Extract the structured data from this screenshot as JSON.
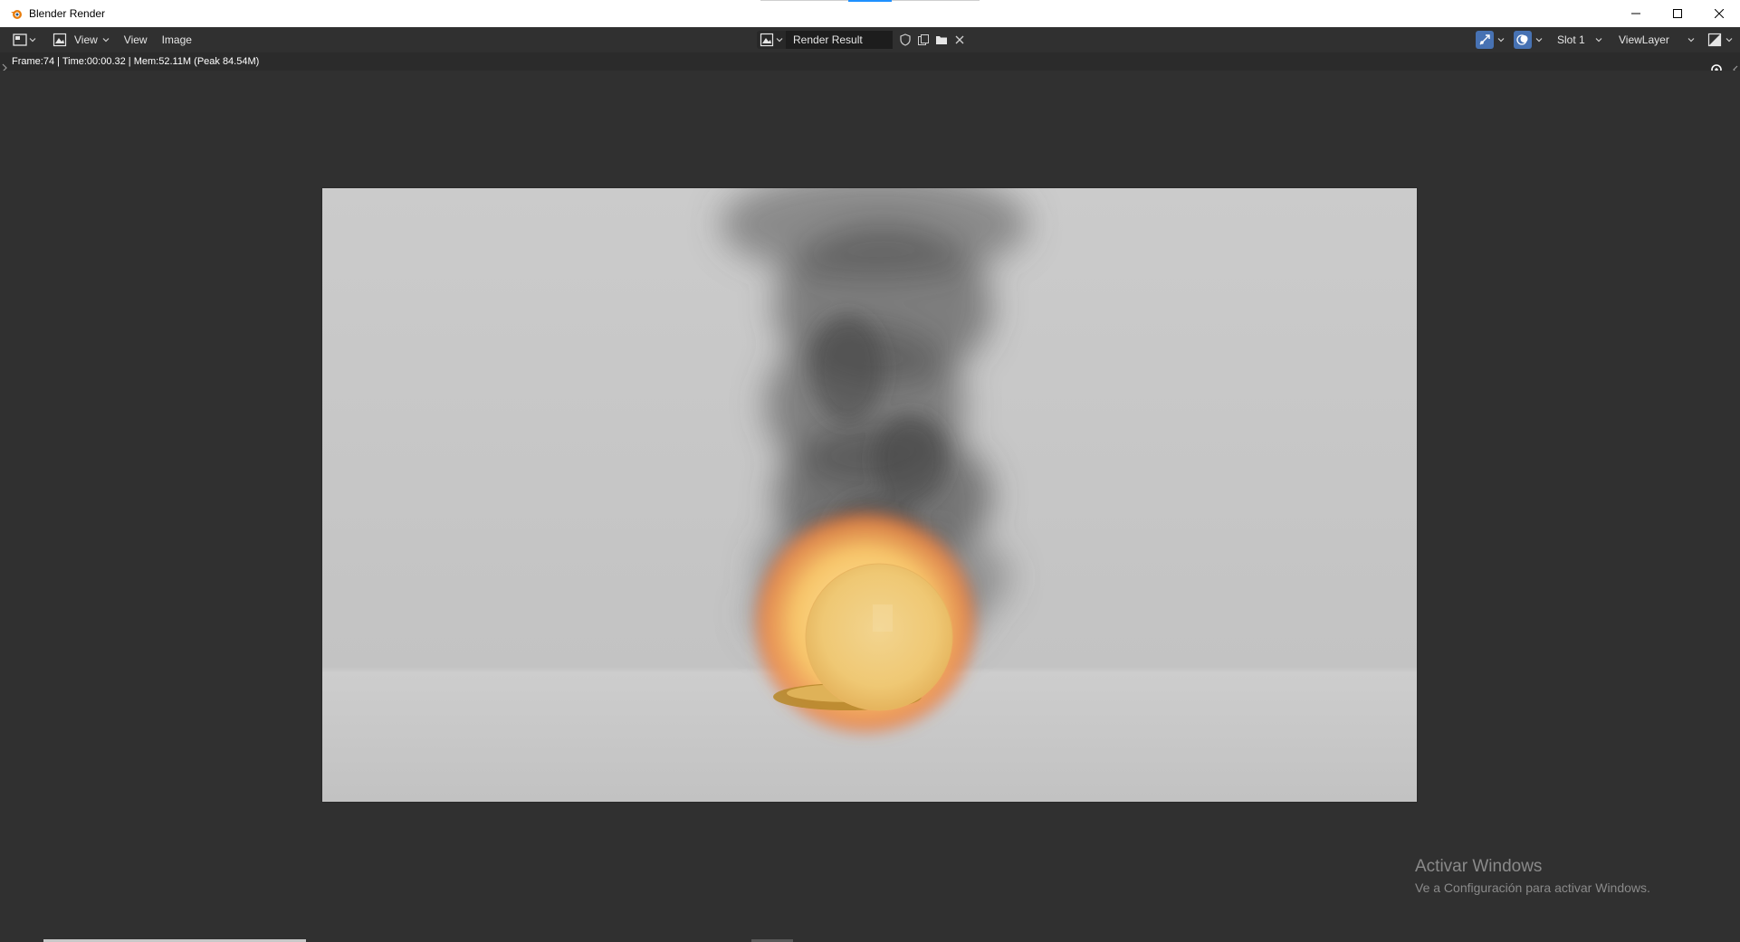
{
  "window": {
    "title": "Blender Render",
    "controls": [
      "minimize",
      "maximize",
      "close"
    ]
  },
  "header": {
    "editor_type_icon": "image-editor-icon",
    "menus": {
      "view_dropdown": "View",
      "view": "View",
      "image": "Image"
    },
    "image_name": "Render Result",
    "slot": "Slot 1",
    "view_layer": "ViewLayer"
  },
  "info": {
    "text": "Frame:74 | Time:00:00.32 | Mem:52.11M (Peak 84.54M)"
  },
  "watermark": {
    "title": "Activar Windows",
    "subtitle": "Ve a Configuración para activar Windows."
  },
  "colors": {
    "background": "#303030",
    "header": "#303030",
    "render_bg": "#c9c9c9",
    "accent": "#4772b3",
    "fire": "#f5c56a"
  }
}
